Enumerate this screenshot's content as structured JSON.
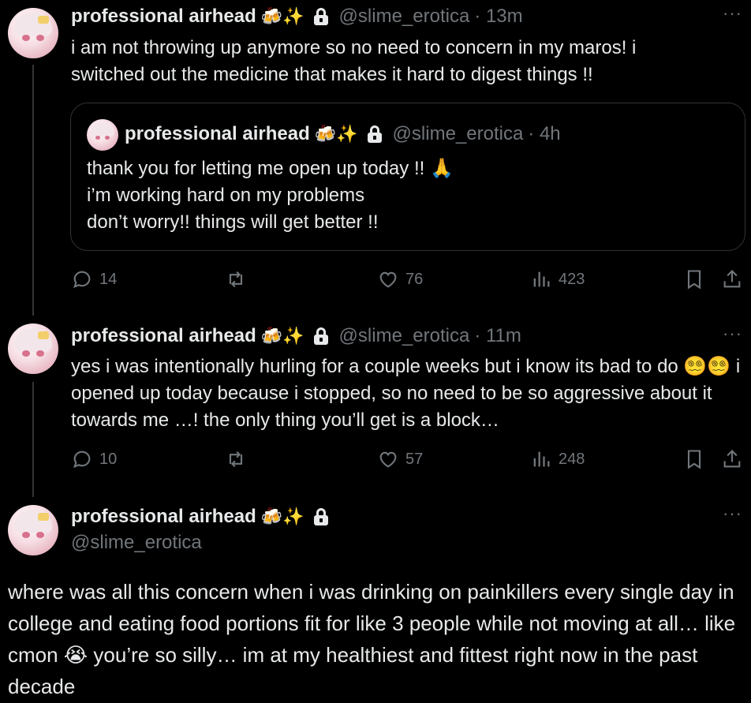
{
  "tweets": [
    {
      "name": "professional airhead",
      "emojis": "🍻✨",
      "handle": "@slime_erotica",
      "time": "· 13m",
      "more": "···",
      "text": "i am not throwing up anymore so no need to concern in my maros! i switched out the medicine that makes it hard to digest things !!",
      "quote": {
        "name": "professional airhead",
        "emojis": "🍻✨",
        "handle": "@slime_erotica",
        "time": "· 4h",
        "lines": [
          "thank you for letting me open up today !! 🙏",
          "i’m working hard on my problems",
          "don’t worry!! things will get better !!"
        ]
      },
      "stats": {
        "replies": "14",
        "likes": "76",
        "views": "423"
      }
    },
    {
      "name": "professional airhead",
      "emojis": "🍻✨",
      "handle": "@slime_erotica",
      "time": "· 11m",
      "more": "···",
      "text": "yes i was intentionally hurling for a couple weeks but i know its bad to do 😵‍💫😵‍💫 i opened up today because i stopped, so no need to be so aggressive about it towards me …! the only thing you’ll get is a block…",
      "stats": {
        "replies": "10",
        "likes": "57",
        "views": "248"
      }
    },
    {
      "name": "professional airhead",
      "emojis": "🍻✨",
      "handle": "@slime_erotica",
      "more": "···",
      "text": "where was all this concern when i was drinking on painkillers every single day in college and eating food portions fit for like 3 people while not moving at all… like cmon 😭 you’re so silly… im at my healthiest and fittest right now in the past decade"
    }
  ],
  "icons": [
    "reply-icon",
    "retweet-icon",
    "like-icon",
    "views-icon",
    "bookmark-icon",
    "share-icon",
    "lock-icon",
    "more-icon"
  ],
  "colors": {
    "background": "#000000",
    "text": "#e7e9ea",
    "muted": "#71767b",
    "border": "#2f3336"
  }
}
